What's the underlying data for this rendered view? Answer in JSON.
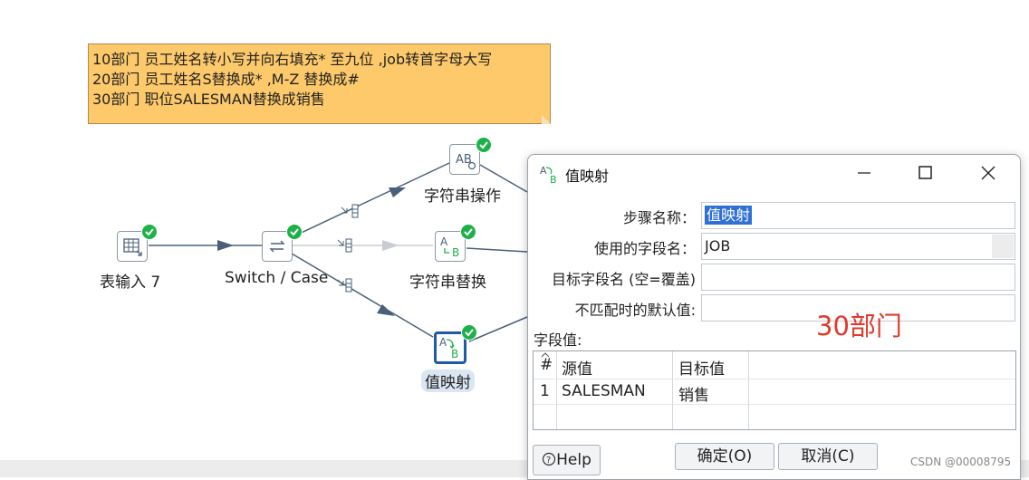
{
  "note": {
    "lines": [
      "10部门 员工姓名转小写并向右填充* 至九位 ,job转首字母大写",
      "20部门 员工姓名S替换成* ,M-Z 替换成#",
      "30部门 职位SALESMAN替换成销售"
    ]
  },
  "steps": {
    "table_input": "表输入 7",
    "switch_case": "Switch / Case",
    "string_ops": "字符串操作",
    "string_replace": "字符串替换",
    "value_mapper": "值映射"
  },
  "dialog": {
    "title": "值映射",
    "step_name_label": "步骤名称：",
    "step_name_value": "值映射",
    "field_label": "使用的字段名：",
    "field_value": "JOB",
    "target_label": "目标字段名 (空=覆盖)",
    "target_value": "",
    "default_label": "不匹配时的默认值:",
    "default_value": "",
    "annotation": "30部门",
    "values_label": "字段值:",
    "table": {
      "headers": [
        "#",
        "源值",
        "目标值"
      ],
      "rows": [
        [
          "1",
          "SALESMAN",
          "销售"
        ]
      ]
    },
    "help_label": "Help",
    "ok_label": "确定(O)",
    "cancel_label": "取消(C)"
  },
  "watermark": "CSDN @00008795",
  "colors": {
    "note_bg": "#fdc96a",
    "ok_badge": "#1eb14a",
    "selection": "#2f6fd6",
    "annotation": "#e2392c",
    "hop": "#4a6078"
  }
}
